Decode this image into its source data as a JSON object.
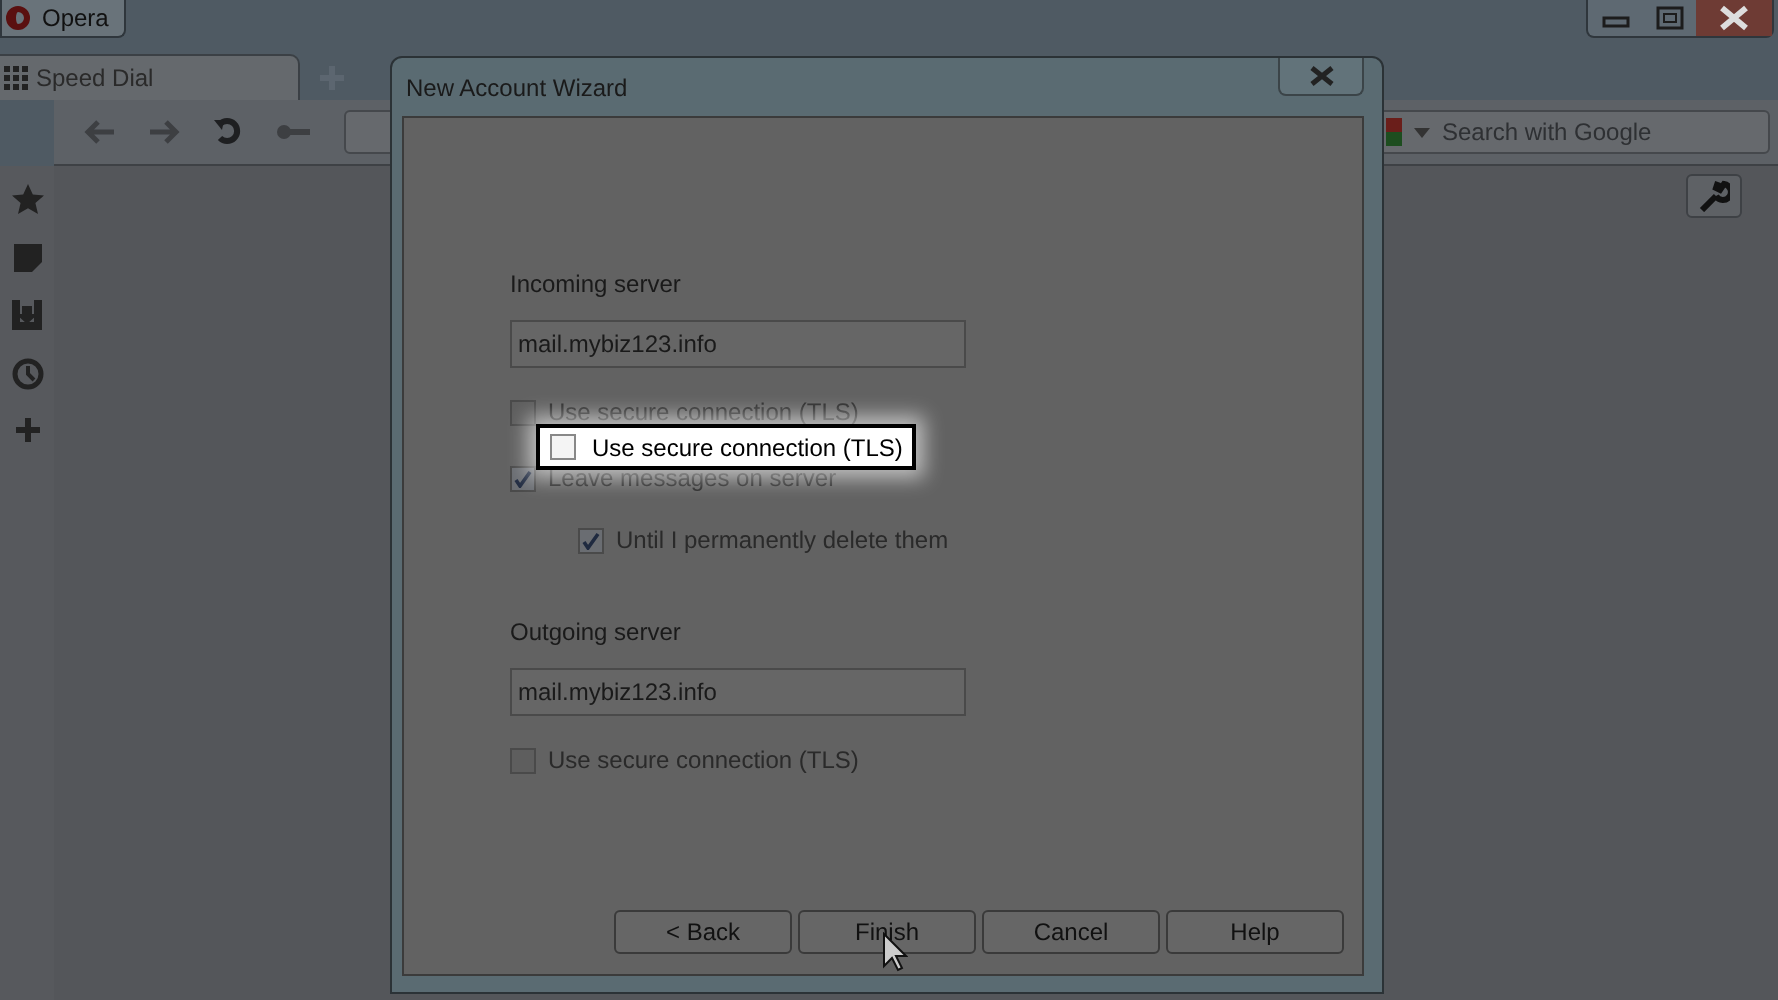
{
  "browser": {
    "menu_button": "Opera",
    "tabs": [
      {
        "label": "Speed Dial",
        "selected": true
      }
    ],
    "search": {
      "placeholder": "Search with Google"
    }
  },
  "dialog": {
    "title": "New Account Wizard",
    "items": [
      {
        "kind": "heading",
        "text": "Incoming server"
      },
      {
        "kind": "field",
        "value": "mail.mybiz123.info"
      },
      {
        "kind": "checkbox",
        "label": "Use secure connection (TLS)",
        "checked": false
      },
      {
        "kind": "checkbox",
        "label": "Leave messages on server",
        "checked": true,
        "children": [
          {
            "kind": "checkbox",
            "label": "Until I permanently delete them",
            "checked": true
          }
        ]
      },
      {
        "kind": "heading",
        "text": "Outgoing server"
      },
      {
        "kind": "field",
        "value": "mail.mybiz123.info"
      },
      {
        "kind": "checkbox",
        "label": "Use secure connection (TLS)",
        "checked": false
      }
    ],
    "buttons": [
      "< Back",
      "Finish",
      "Cancel",
      "Help"
    ]
  },
  "callout": {
    "label": "Use secure connection (TLS)",
    "checked": false
  }
}
